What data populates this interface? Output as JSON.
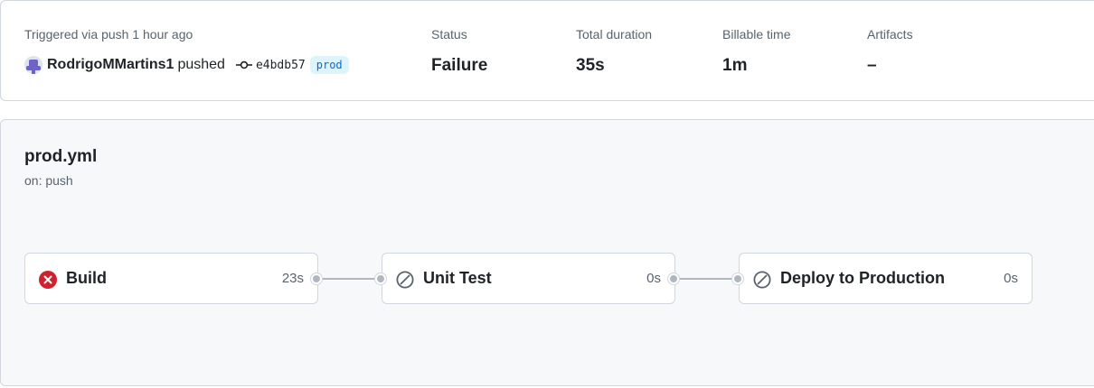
{
  "summary": {
    "trigger_label": "Triggered via push 1 hour ago",
    "user": "RodrigoMMartins1",
    "action": "pushed",
    "commit_sha": "e4bdb57",
    "branch": "prod",
    "status_label": "Status",
    "status_value": "Failure",
    "duration_label": "Total duration",
    "duration_value": "35s",
    "billable_label": "Billable time",
    "billable_value": "1m",
    "artifacts_label": "Artifacts",
    "artifacts_value": "–"
  },
  "workflow": {
    "file": "prod.yml",
    "trigger": "on: push",
    "jobs": [
      {
        "name": "Build",
        "duration": "23s",
        "state": "failure",
        "icon": "x-circle-fill-icon"
      },
      {
        "name": "Unit Test",
        "duration": "0s",
        "state": "skipped",
        "icon": "skip-icon"
      },
      {
        "name": "Deploy to Production",
        "duration": "0s",
        "state": "skipped",
        "icon": "skip-icon"
      }
    ]
  },
  "colors": {
    "failure": "#cf222e",
    "skipped": "#59636e",
    "branch_bg": "#ddf4ff",
    "branch_text": "#0969da",
    "connector": "#afb8c1"
  }
}
